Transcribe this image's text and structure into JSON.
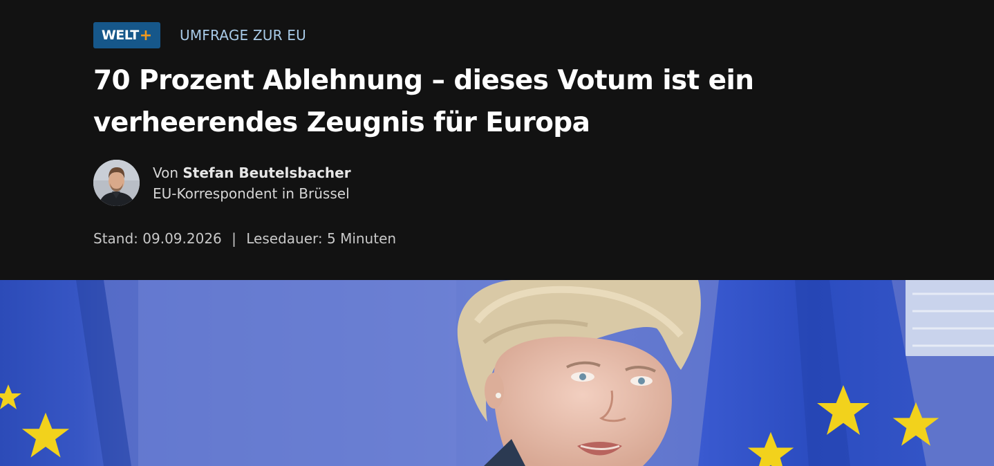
{
  "badge": {
    "brand": "WELT",
    "plus": "+",
    "brand_color": "#16578a",
    "plus_color": "#f39a1d"
  },
  "kicker": "UMFRAGE ZUR EU",
  "headline": "70 Prozent Ablehnung – dieses Votum ist ein verheerendes Zeugnis für Europa",
  "author": {
    "prefix": "Von",
    "name": "Stefan Beutelsbacher",
    "role": "EU-Korrespondent in Brüssel",
    "avatar_icon": "author-portrait"
  },
  "meta": {
    "stand_label": "Stand:",
    "date": "09.09.2026",
    "separator": "|",
    "reading_label": "Lesedauer:",
    "reading_time": "5 Minuten"
  },
  "hero_image": {
    "subject": "hero-photo",
    "background_color": "#5b6fc9",
    "flag_color": "#2f4fbf",
    "star_color": "#f2d21c"
  }
}
